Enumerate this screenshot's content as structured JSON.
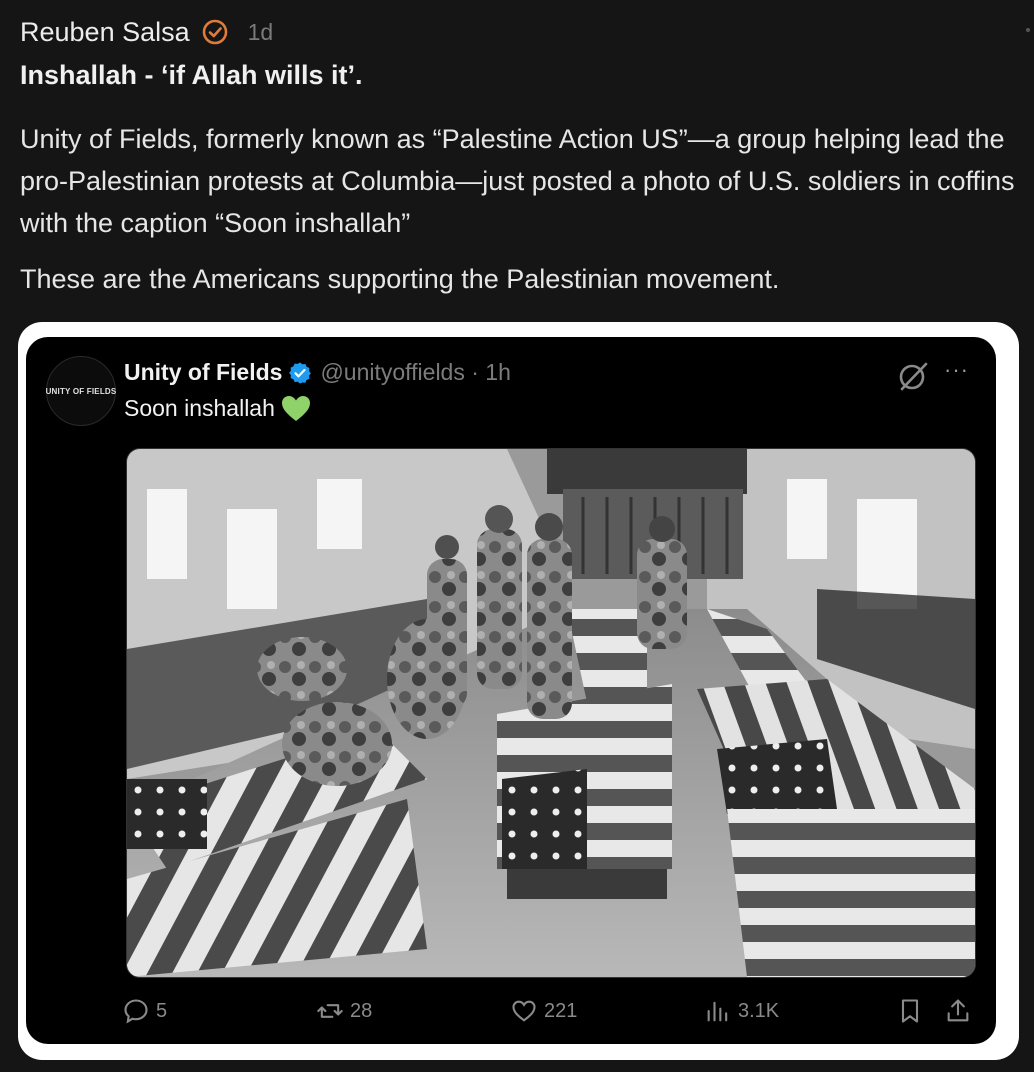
{
  "post": {
    "author": "Reuben Salsa",
    "time": "1d",
    "title": "Inshallah - ‘if Allah wills it’.",
    "body": "Unity of Fields, formerly known as “Palestine Action US”—a group helping lead the pro-Palestinian protests at Columbia—just posted a photo of U.S. soldiers in coffins with the caption “Soon inshallah”",
    "body2": "These are the Americans supporting the Palestinian movement."
  },
  "embed": {
    "avatar_text": "UNITY OF FIELDS",
    "name": "Unity of Fields",
    "handle_time": "@unityoffields · 1h",
    "text": "Soon inshallah",
    "more": "···",
    "stats": {
      "replies": "5",
      "retweets": "28",
      "likes": "221",
      "views": "3.1K"
    }
  },
  "icons": {
    "author_badge": "verified-circle-check-icon",
    "tweet_badge": "verified-blue-icon",
    "emoji": "green-heart-icon",
    "grok": "grok-icon"
  },
  "colors": {
    "badge_orange": "#e07b39",
    "verified_blue": "#1d9bf0",
    "heart_green": "#8fd26a"
  }
}
